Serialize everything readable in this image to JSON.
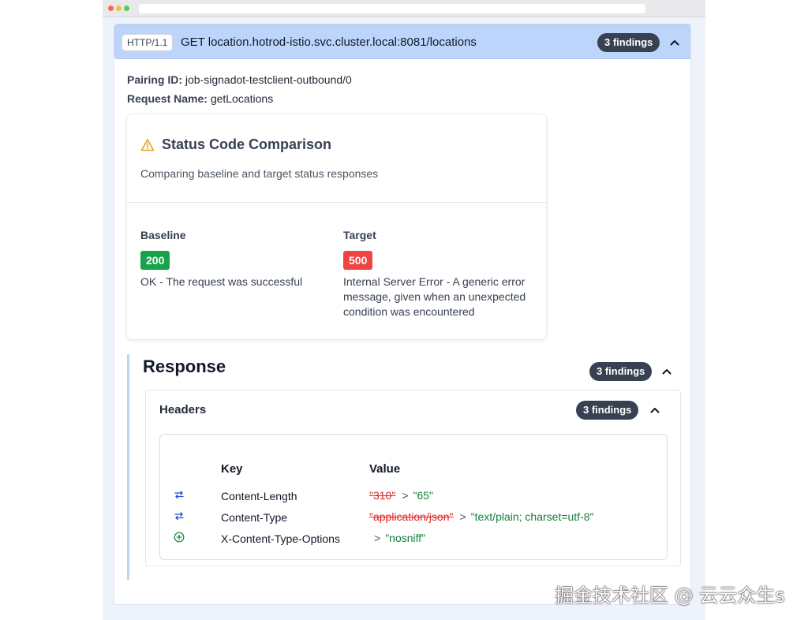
{
  "request": {
    "protocol": "HTTP/1.1",
    "title": "GET location.hotrod-istio.svc.cluster.local:8081/locations",
    "findings": "3 findings"
  },
  "meta": {
    "pairing_label": "Pairing ID:",
    "pairing_value": "job-signadot-testclient-outbound/0",
    "request_name_label": "Request Name:",
    "request_name_value": "getLocations"
  },
  "status_card": {
    "title": "Status Code Comparison",
    "subtitle": "Comparing baseline and target status responses",
    "warning_color": "#e8a317",
    "baseline": {
      "label": "Baseline",
      "code": "200",
      "color": "#16a34a",
      "description": "OK - The request was successful"
    },
    "target": {
      "label": "Target",
      "code": "500",
      "color": "#ef4444",
      "description": "Internal Server Error - A generic error message, given when an unexpected condition was encountered"
    }
  },
  "response": {
    "title": "Response",
    "findings": "3 findings",
    "headers": {
      "title": "Headers",
      "findings": "3 findings",
      "columns": {
        "key": "Key",
        "value": "Value"
      },
      "rows": [
        {
          "icon": "swap-icon",
          "key": "Content-Length",
          "old": "\"310\"",
          "arrow": ">",
          "new": "\"65\""
        },
        {
          "icon": "swap-icon",
          "key": "Content-Type",
          "old": "\"application/json\"",
          "arrow": ">",
          "new": "\"text/plain; charset=utf-8\""
        },
        {
          "icon": "add-icon",
          "key": "X-Content-Type-Options",
          "old": "",
          "arrow": ">",
          "new": "\"nosniff\""
        }
      ]
    }
  },
  "watermark": "掘金技术社区 @ 云云众生s"
}
